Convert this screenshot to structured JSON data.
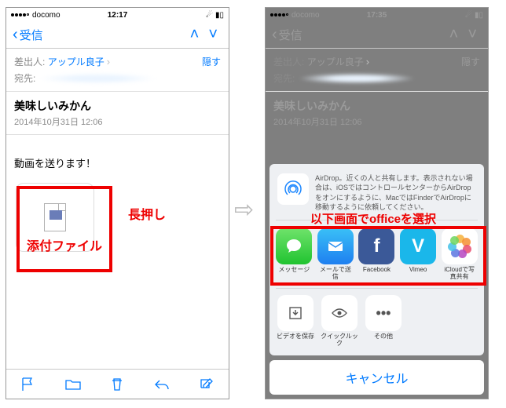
{
  "left": {
    "status": {
      "carrier": "docomo",
      "time": "12:17"
    },
    "nav": {
      "back": "受信"
    },
    "sender_label": "差出人:",
    "sender": "アップル良子",
    "hide": "隠す",
    "to_label": "宛先:",
    "subject": "美味しいみかん",
    "date": "2014年10月31日 12:06",
    "body": "動画を送ります！"
  },
  "right": {
    "status": {
      "carrier": "docomo",
      "time": "17:35"
    },
    "nav": {
      "back": "受信"
    },
    "sender_label": "差出人:",
    "sender": "アップル良子",
    "hide": "隠す",
    "to_label": "宛先:",
    "subject": "美味しいみかん",
    "date": "2014年10月31日 12:06",
    "airdrop": "AirDrop。近くの人と共有します。表示されない場合は、iOSではコントロールセンターからAirDropをオンにするように、MacではFinderでAirDropに移動するように依頼してください。",
    "share": [
      {
        "label": "メッセージ"
      },
      {
        "label": "メールで送信"
      },
      {
        "label": "Facebook"
      },
      {
        "label": "Vimeo"
      },
      {
        "label": "iCloudで写真共有"
      }
    ],
    "actions": [
      {
        "label": "ビデオを保存"
      },
      {
        "label": "クイックルック"
      },
      {
        "label": "その他"
      }
    ],
    "cancel": "キャンセル"
  },
  "annotations": {
    "attach": "添付ファイル",
    "longpress": "長押し",
    "select_office": "以下画面でofficeを選択"
  }
}
